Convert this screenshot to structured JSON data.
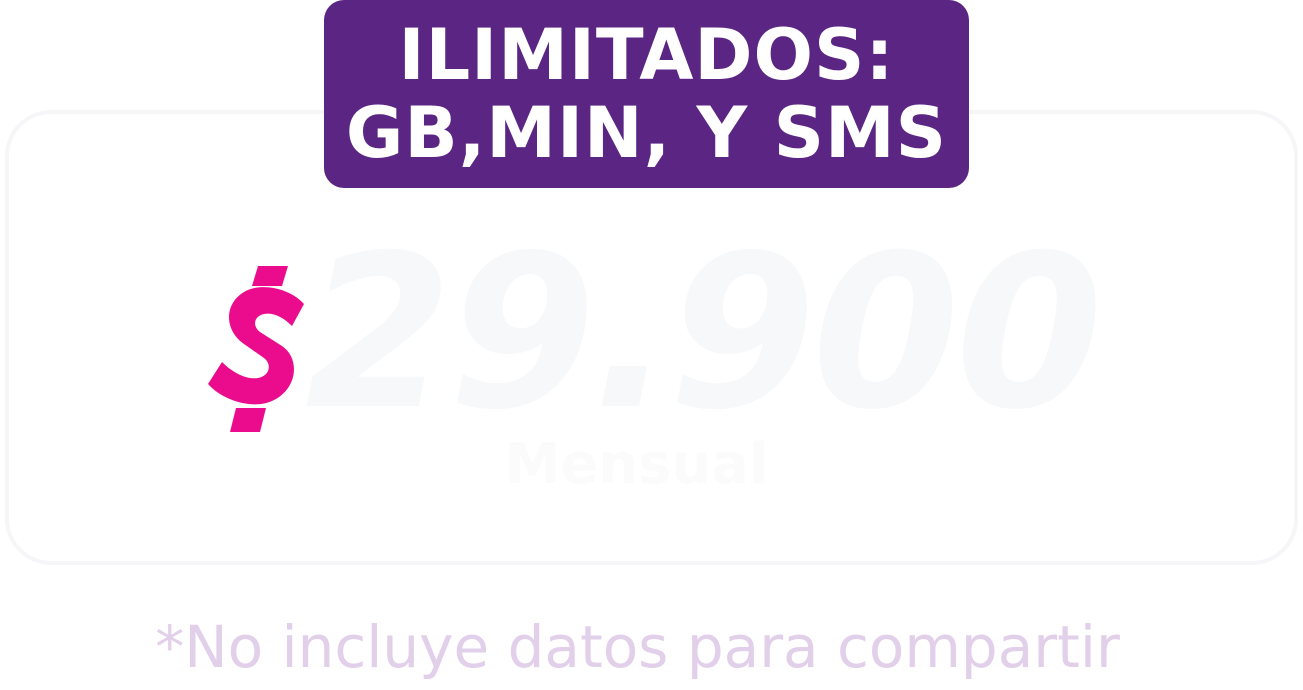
{
  "badge": {
    "line1": "ILIMITADOS:",
    "line2": "GB,MIN, Y SMS"
  },
  "price": {
    "currency_symbol": "$",
    "amount": "29.900",
    "period": "Mensual"
  },
  "footnote": "*No incluye datos para compartir",
  "colors": {
    "badge_bg": "#5b2683",
    "currency": "#ea0c8c",
    "footnote": "#e2cfea"
  }
}
